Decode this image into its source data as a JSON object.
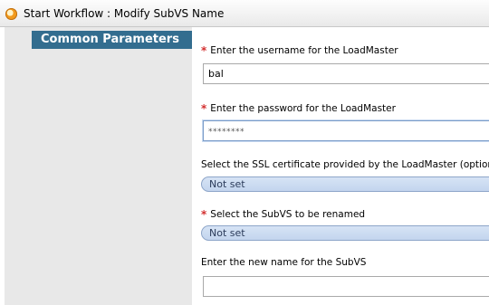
{
  "window": {
    "title": "Start Workflow : Modify SubVS Name",
    "icon": "workflow-icon"
  },
  "sidebar": {
    "header": "Common Parameters"
  },
  "form": {
    "username": {
      "required_marker": "*",
      "label": "Enter the username for the LoadMaster",
      "value": "bal"
    },
    "password": {
      "required_marker": "*",
      "label": "Enter the password for the LoadMaster",
      "value": "********"
    },
    "ssl_certificate": {
      "label": "Select the SSL certificate provided by the LoadMaster (optional)",
      "value": "Not set"
    },
    "subvs": {
      "required_marker": "*",
      "label": "Select the SubVS to be renamed",
      "value": "Not set"
    },
    "new_name": {
      "label": "Enter the new name for the SubVS",
      "value": ""
    }
  },
  "colors": {
    "sidebar_header_bg": "#336d8f",
    "required_marker": "#d32f2f",
    "select_bg": "#c9daf0"
  }
}
